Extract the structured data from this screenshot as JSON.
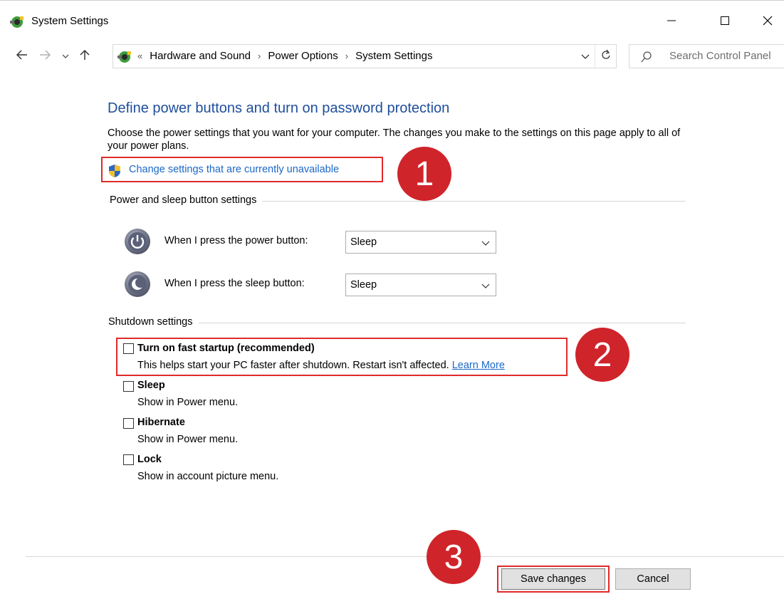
{
  "window": {
    "title": "System Settings"
  },
  "titlebar_controls": {
    "minimize_icon": "minimize-icon",
    "maximize_icon": "maximize-icon",
    "close_icon": "close-icon"
  },
  "address_bar": {
    "overflow": "«",
    "breadcrumbs": [
      "Hardware and Sound",
      "Power Options",
      "System Settings"
    ],
    "separator": "›"
  },
  "search": {
    "placeholder": "Search Control Panel"
  },
  "content": {
    "heading": "Define power buttons and turn on password protection",
    "description": "Choose the power settings that you want for your computer. The changes you make to the settings on this page apply to all of your power plans.",
    "change_link": "Change settings that are currently unavailable"
  },
  "power_section": {
    "label": "Power and sleep button settings",
    "rows": [
      {
        "label": "When I press the power button:",
        "value": "Sleep"
      },
      {
        "label": "When I press the sleep button:",
        "value": "Sleep"
      }
    ]
  },
  "shutdown_section": {
    "label": "Shutdown settings",
    "options": [
      {
        "title": "Turn on fast startup (recommended)",
        "desc": "This helps start your PC faster after shutdown. Restart isn't affected.",
        "link": "Learn More",
        "checked": false
      },
      {
        "title": "Sleep",
        "desc": "Show in Power menu.",
        "checked": false
      },
      {
        "title": "Hibernate",
        "desc": "Show in Power menu.",
        "checked": false
      },
      {
        "title": "Lock",
        "desc": "Show in account picture menu.",
        "checked": false
      }
    ]
  },
  "annotations": {
    "badge_1": "1",
    "badge_2": "2",
    "badge_3": "3",
    "highlight_color": "#e02a2a",
    "badge_color": "#d0242b"
  },
  "footer": {
    "save_label": "Save changes",
    "cancel_label": "Cancel"
  },
  "colors": {
    "heading": "#1e4e9c",
    "link": "#1a68c8"
  }
}
